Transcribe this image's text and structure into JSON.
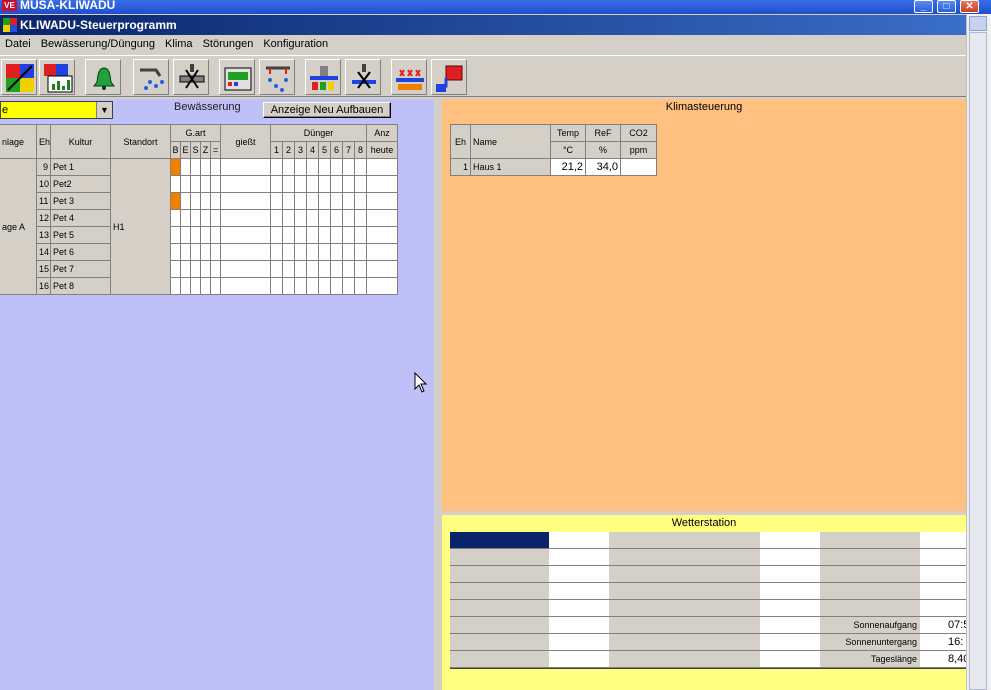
{
  "window": {
    "outer_title": "MUSA-KLIWADU",
    "outer_icon": "VE",
    "inner_title": "KLIWADU-Steuerprogramm"
  },
  "menu": [
    "Datei",
    "Bewässerung/Düngung",
    "Klima",
    "Störungen",
    "Konfiguration"
  ],
  "toolbar": {
    "icons": [
      "chart-config-icon",
      "chart-report-icon",
      "bell-icon",
      "irrigation-icon",
      "valve-icon",
      "controller-icon",
      "sprinkler-icon",
      "pump-line-icon",
      "mixer-valve-icon",
      "fertilizer-dosing-icon",
      "tank-icon"
    ]
  },
  "bewaesserung": {
    "combo_value": "e",
    "label": "Bewässerung",
    "rebuild_button": "Anzeige Neu Aufbauen",
    "headers": {
      "anlage": "nlage",
      "eh": "Eh",
      "kultur": "Kultur",
      "standort": "Standort",
      "gart": "G.art",
      "giesst": "gießt",
      "duenger": "Dünger",
      "anz": "Anz",
      "heute": "heute",
      "gart_sub": [
        "B",
        "E",
        "S",
        "Z",
        "="
      ],
      "duenger_sub": [
        "1",
        "2",
        "3",
        "4",
        "5",
        "6",
        "7",
        "8"
      ]
    },
    "anlage_value": "age A",
    "standort_value": "H1",
    "rows": [
      {
        "eh": "9",
        "kultur": "Pet 1",
        "b_active": true
      },
      {
        "eh": "10",
        "kultur": "Pet2",
        "b_active": false
      },
      {
        "eh": "11",
        "kultur": "Pet 3",
        "b_active": true
      },
      {
        "eh": "12",
        "kultur": "Pet 4",
        "b_active": false
      },
      {
        "eh": "13",
        "kultur": "Pet 5",
        "b_active": false
      },
      {
        "eh": "14",
        "kultur": "Pet 6",
        "b_active": false
      },
      {
        "eh": "15",
        "kultur": "Pet 7",
        "b_active": false
      },
      {
        "eh": "16",
        "kultur": "Pet 8",
        "b_active": false
      }
    ],
    "active_color": "#f08000"
  },
  "klima": {
    "label": "Klimasteuerung",
    "headers": {
      "eh": "Eh",
      "name": "Name",
      "temp": "Temp",
      "ref": "ReF",
      "co2": "CO2",
      "temp_unit": "°C",
      "ref_unit": "%",
      "co2_unit": "ppm"
    },
    "rows": [
      {
        "eh": "1",
        "name": "Haus 1",
        "temp": "21,2",
        "ref": "34,0",
        "co2": ""
      }
    ]
  },
  "wetter": {
    "label": "Wetterstation",
    "sunrise_label": "Sonnenaufgang",
    "sunrise_value": "07:5",
    "sunset_label": "Sonnenuntergang",
    "sunset_value": "16:",
    "daylength_label": "Tageslänge",
    "daylength_value": "8,40"
  },
  "colors": {
    "left_pane": "#c0c0f8",
    "right_pane": "#ffc080",
    "wetter_pane": "#ffff80",
    "header_selected": "#0a246a"
  }
}
